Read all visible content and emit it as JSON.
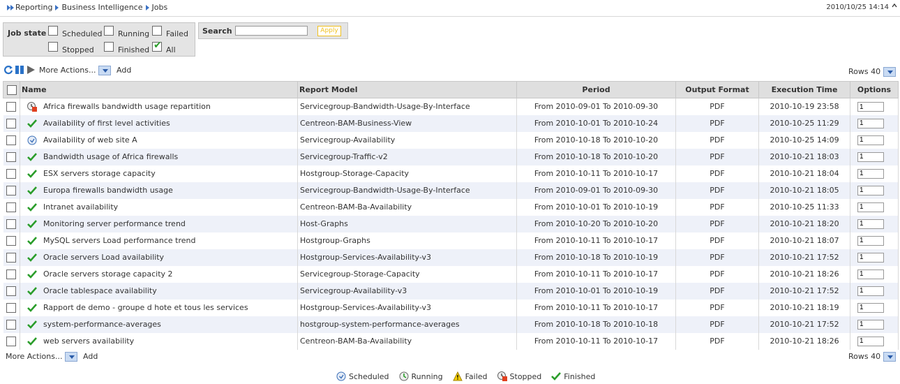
{
  "breadcrumb": {
    "items": [
      "Reporting",
      "Business Intelligence",
      "Jobs"
    ]
  },
  "datetime": "2010/10/25 14:14",
  "job_state": {
    "label": "Job state",
    "options": [
      {
        "label": "Scheduled",
        "checked": false
      },
      {
        "label": "Running",
        "checked": false
      },
      {
        "label": "Failed",
        "checked": false
      },
      {
        "label": "Stopped",
        "checked": false
      },
      {
        "label": "Finished",
        "checked": false
      },
      {
        "label": "All",
        "checked": true
      }
    ]
  },
  "search": {
    "label": "Search",
    "value": "",
    "apply_label": "Apply"
  },
  "toolbar": {
    "more_actions": "More Actions...",
    "add": "Add",
    "rows_label": "Rows",
    "rows_value": "40"
  },
  "table": {
    "headers": [
      "Name",
      "Report Model",
      "Period",
      "Output Format",
      "Execution Time",
      "Options"
    ],
    "rows": [
      {
        "status": "failed-stopped",
        "name": "Africa firewalls bandwidth usage repartition",
        "model": "Servicegroup-Bandwidth-Usage-By-Interface",
        "period": "From 2010-09-01 To 2010-09-30",
        "format": "PDF",
        "exec": "2010-10-19 23:58",
        "opt": "1"
      },
      {
        "status": "finished",
        "name": "Availability of first level activities",
        "model": "Centreon-BAM-Business-View",
        "period": "From 2010-10-01 To 2010-10-24",
        "format": "PDF",
        "exec": "2010-10-25 11:29",
        "opt": "1"
      },
      {
        "status": "scheduled",
        "name": "Availability of web site A",
        "model": "Servicegroup-Availability",
        "period": "From 2010-10-18 To 2010-10-20",
        "format": "PDF",
        "exec": "2010-10-25 14:09",
        "opt": "1"
      },
      {
        "status": "finished",
        "name": "Bandwidth usage of Africa firewalls",
        "model": "Servicegroup-Traffic-v2",
        "period": "From 2010-10-18 To 2010-10-20",
        "format": "PDF",
        "exec": "2010-10-21 18:03",
        "opt": "1"
      },
      {
        "status": "finished",
        "name": "ESX servers storage capacity",
        "model": "Hostgroup-Storage-Capacity",
        "period": "From 2010-10-11 To 2010-10-17",
        "format": "PDF",
        "exec": "2010-10-21 18:04",
        "opt": "1"
      },
      {
        "status": "finished",
        "name": "Europa firewalls bandwidth usage",
        "model": "Servicegroup-Bandwidth-Usage-By-Interface",
        "period": "From 2010-09-01 To 2010-09-30",
        "format": "PDF",
        "exec": "2010-10-21 18:05",
        "opt": "1"
      },
      {
        "status": "finished",
        "name": "Intranet availability",
        "model": "Centreon-BAM-Ba-Availability",
        "period": "From 2010-10-01 To 2010-10-19",
        "format": "PDF",
        "exec": "2010-10-25 11:33",
        "opt": "1"
      },
      {
        "status": "finished",
        "name": "Monitoring server performance trend",
        "model": "Host-Graphs",
        "period": "From 2010-10-20 To 2010-10-20",
        "format": "PDF",
        "exec": "2010-10-21 18:20",
        "opt": "1"
      },
      {
        "status": "finished",
        "name": "MySQL servers Load performance trend",
        "model": "Hostgroup-Graphs",
        "period": "From 2010-10-11 To 2010-10-17",
        "format": "PDF",
        "exec": "2010-10-21 18:07",
        "opt": "1"
      },
      {
        "status": "finished",
        "name": "Oracle servers Load availability",
        "model": "Hostgroup-Services-Availability-v3",
        "period": "From 2010-10-18 To 2010-10-19",
        "format": "PDF",
        "exec": "2010-10-21 17:52",
        "opt": "1"
      },
      {
        "status": "finished",
        "name": "Oracle servers storage capacity 2",
        "model": "Servicegroup-Storage-Capacity",
        "period": "From 2010-10-11 To 2010-10-17",
        "format": "PDF",
        "exec": "2010-10-21 18:26",
        "opt": "1"
      },
      {
        "status": "finished",
        "name": "Oracle tablespace availability",
        "model": "Servicegroup-Availability-v3",
        "period": "From 2010-10-01 To 2010-10-19",
        "format": "PDF",
        "exec": "2010-10-21 17:52",
        "opt": "1"
      },
      {
        "status": "finished",
        "name": "Rapport de demo - groupe d hote et tous les services",
        "model": "Hostgroup-Services-Availability-v3",
        "period": "From 2010-10-11 To 2010-10-17",
        "format": "PDF",
        "exec": "2010-10-21 18:19",
        "opt": "1"
      },
      {
        "status": "finished",
        "name": "system-performance-averages",
        "model": "hostgroup-system-performance-averages",
        "period": "From 2010-10-18 To 2010-10-18",
        "format": "PDF",
        "exec": "2010-10-21 17:52",
        "opt": "1"
      },
      {
        "status": "finished",
        "name": "web servers availability",
        "model": "Centreon-BAM-Ba-Availability",
        "period": "From 2010-10-11 To 2010-10-17",
        "format": "PDF",
        "exec": "2010-10-21 18:26",
        "opt": "1"
      }
    ]
  },
  "legend": [
    {
      "icon": "clock-icon",
      "label": "Scheduled"
    },
    {
      "icon": "running-icon",
      "label": "Running"
    },
    {
      "icon": "warning-icon",
      "label": "Failed"
    },
    {
      "icon": "stopped-icon",
      "label": "Stopped"
    },
    {
      "icon": "check-icon",
      "label": "Finished"
    }
  ],
  "colors": {
    "accent": "#3b72c4",
    "check": "#2a9d2a",
    "header_bg": "#dfdfdf",
    "row_alt": "#eef1f9",
    "apply": "#f0c020"
  }
}
